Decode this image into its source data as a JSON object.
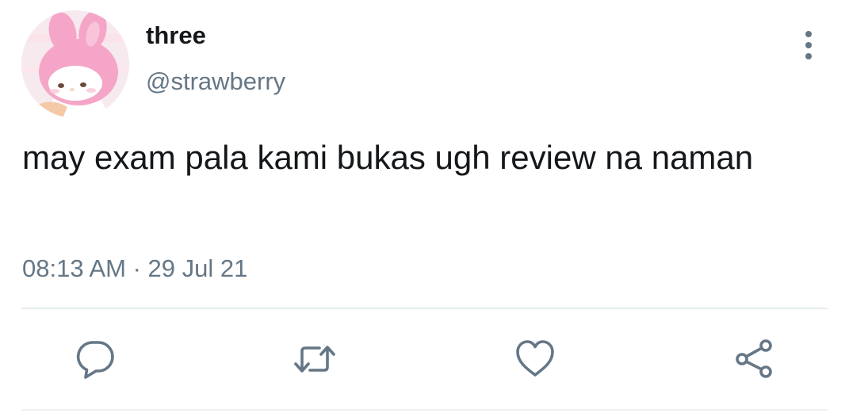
{
  "author": {
    "display_name": "three",
    "handle": "@strawberry"
  },
  "tweet": {
    "text": "may exam pala kami bukas ugh review na naman",
    "timestamp": "08:13 AM · 29 Jul 21"
  },
  "actions": [
    {
      "name": "reply",
      "icon": "reply-icon"
    },
    {
      "name": "retweet",
      "icon": "retweet-icon"
    },
    {
      "name": "like",
      "icon": "heart-icon"
    },
    {
      "name": "share",
      "icon": "share-icon"
    }
  ],
  "colors": {
    "text": "#14171a",
    "secondary": "#657786",
    "divider": "#e6ecf0",
    "avatar_pink": "#f5a6c8"
  }
}
